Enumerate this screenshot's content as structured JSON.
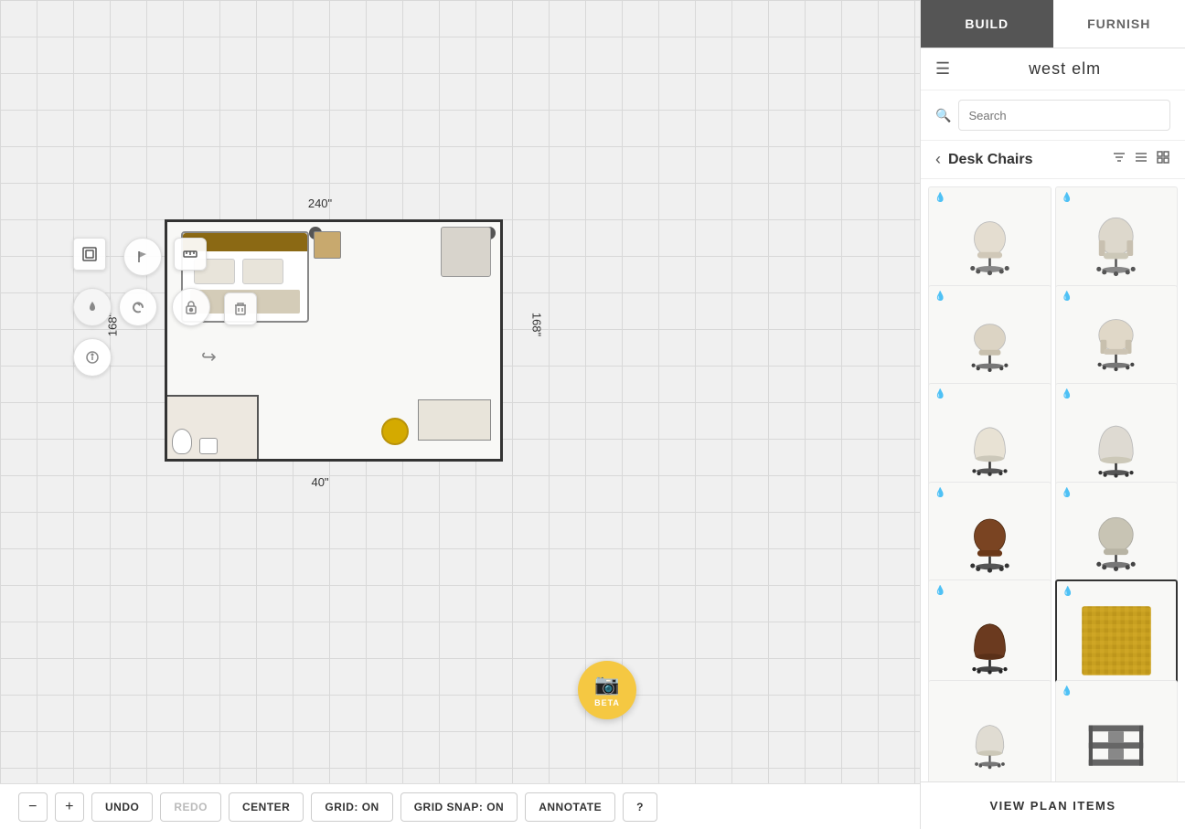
{
  "tabs": {
    "build": "BUILD",
    "furnish": "FURNISH",
    "active": "build"
  },
  "brand": {
    "name": "west elm",
    "menu_icon": "☰"
  },
  "search": {
    "placeholder": "Search"
  },
  "category": {
    "title": "Desk Chairs",
    "back_icon": "‹"
  },
  "filter_icons": {
    "filter": "⊟",
    "list": "≡",
    "grid": "⊞"
  },
  "products": [
    {
      "id": 1,
      "alt": "Desk Chair Light Beige 1",
      "has_swatch": true,
      "selected": false,
      "color": "#e8e2d8",
      "accent": "#c8bfae",
      "type": "office_chair"
    },
    {
      "id": 2,
      "alt": "Desk Chair Light Beige 2",
      "has_swatch": true,
      "selected": false,
      "color": "#e0dbd0",
      "accent": "#c0baa8",
      "type": "office_chair_arms"
    },
    {
      "id": 3,
      "alt": "Desk Chair Low Back",
      "has_swatch": true,
      "selected": false,
      "color": "#dcd8cc",
      "accent": "#bcb8a8",
      "type": "office_chair_low"
    },
    {
      "id": 4,
      "alt": "Desk Chair Mid Back",
      "has_swatch": true,
      "selected": false,
      "color": "#d8d4c8",
      "accent": "#b8b4a0",
      "type": "office_chair_mid"
    },
    {
      "id": 5,
      "alt": "Desk Chair Modern",
      "has_swatch": true,
      "selected": false,
      "color": "#e4e0d6",
      "accent": "#c4c0b0",
      "type": "office_chair_modern"
    },
    {
      "id": 6,
      "alt": "Desk Chair Wide",
      "has_swatch": true,
      "selected": false,
      "color": "#e2ddd3",
      "accent": "#c2bda5",
      "type": "office_chair_wide"
    },
    {
      "id": 7,
      "alt": "Desk Chair Dark Brown",
      "has_swatch": true,
      "selected": false,
      "color": "#6b3a1f",
      "accent": "#4a2810",
      "type": "office_chair_dark"
    },
    {
      "id": 8,
      "alt": "Desk Chair Light Gray",
      "has_swatch": true,
      "selected": false,
      "color": "#c8c4b8",
      "accent": "#a8a498",
      "type": "office_chair_gray"
    },
    {
      "id": 9,
      "alt": "Desk Chair Dark Brown 2",
      "has_swatch": true,
      "selected": false,
      "color": "#5a3018",
      "accent": "#3c2010",
      "type": "office_chair_dark2"
    },
    {
      "id": 10,
      "alt": "Texture Swatch Yellow",
      "has_swatch": true,
      "selected": true,
      "color": "#c8a020",
      "accent": "#b08010",
      "type": "swatch"
    },
    {
      "id": 11,
      "alt": "Desk Chair Light Simple",
      "has_swatch": false,
      "selected": false,
      "color": "#dedad0",
      "accent": "#bebaa8",
      "type": "office_chair_simple"
    },
    {
      "id": 12,
      "alt": "Desk Shelf Unit",
      "has_swatch": true,
      "selected": false,
      "color": "#888888",
      "accent": "#666666",
      "type": "shelf"
    }
  ],
  "dimensions": {
    "top": "240\"",
    "left": "168\"",
    "right": "168\"",
    "bottom": "40\""
  },
  "toolbar": {
    "zoom_out": "−",
    "zoom_in": "+",
    "undo": "UNDO",
    "redo": "REDO",
    "center": "CENTER",
    "grid_on": "GRID: ON",
    "grid_snap_on": "GRID SNAP: ON",
    "annotate": "ANNOTATE",
    "help": "?"
  },
  "camera_btn": {
    "icon": "📷",
    "label": "BETA"
  },
  "view_plan": "VIEW PLAN ITEMS"
}
